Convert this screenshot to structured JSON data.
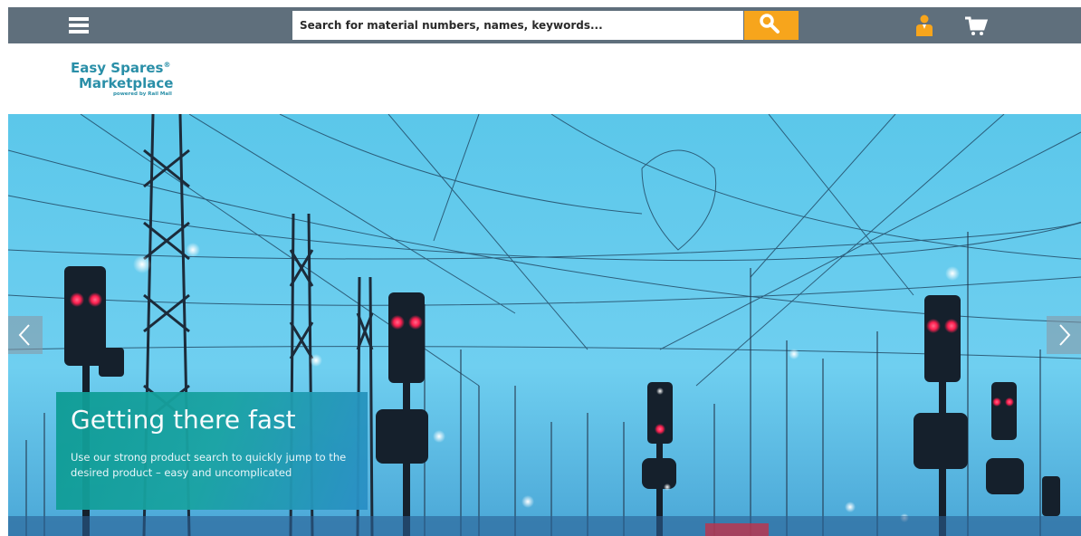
{
  "header": {
    "search_placeholder": "Search for material numbers, names, keywords...",
    "icons": [
      "menu-icon",
      "search-icon",
      "user-icon",
      "cart-icon"
    ],
    "colors": {
      "bar": "#5f6f7c",
      "search_button": "#f7a51c",
      "user_icon": "#f7a51c"
    }
  },
  "logo": {
    "line1": "Easy Spares",
    "registered": "®",
    "line2": "Marketplace",
    "line3": "powered by Rail Mall",
    "color": "#2a8fa8"
  },
  "hero": {
    "title": "Getting there fast",
    "text": "Use our strong product search to quickly jump to the desired product – easy and uncomplicated",
    "prev_icon": "chevron-left-icon",
    "next_icon": "chevron-right-icon"
  }
}
